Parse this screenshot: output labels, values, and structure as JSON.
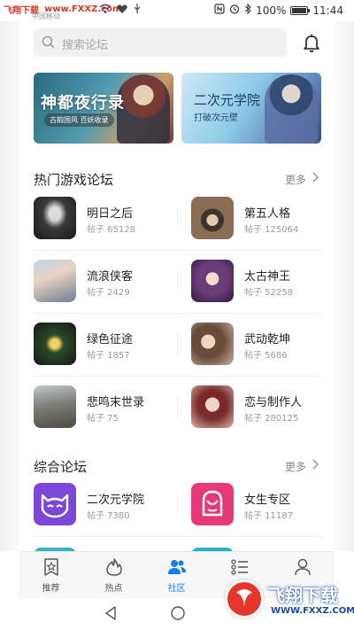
{
  "status_bar": {
    "watermark": "飞翔下载",
    "watermark_url": "www.FXXZ.com",
    "carrier": "中国移动",
    "battery": "100%",
    "battery_level": 1.0,
    "time": "11:44"
  },
  "search": {
    "placeholder": "搜索论坛"
  },
  "banners": [
    {
      "title": "神都夜行录",
      "subtitle": "古韵国风 百妖收录"
    },
    {
      "title": "二次元学院",
      "subtitle": "打破次元壁"
    }
  ],
  "hot_section": {
    "title": "热门游戏论坛",
    "more": "更多",
    "items": [
      {
        "name": "明日之后",
        "posts": "帖子 65128"
      },
      {
        "name": "第五人格",
        "posts": "帖子 125064"
      },
      {
        "name": "流浪侠客",
        "posts": "帖子 2429"
      },
      {
        "name": "太古神王",
        "posts": "帖子 52258"
      },
      {
        "name": "绿色征途",
        "posts": "帖子 1857"
      },
      {
        "name": "武动乾坤",
        "posts": "帖子 5686"
      },
      {
        "name": "悲鸣末世录",
        "posts": "帖子 75"
      },
      {
        "name": "恋与制作人",
        "posts": "帖子 280125"
      }
    ]
  },
  "general_section": {
    "title": "综合论坛",
    "more": "更多",
    "items": [
      {
        "name": "二次元学院",
        "posts": "帖子 7380"
      },
      {
        "name": "女生专区",
        "posts": "帖子 11187"
      }
    ]
  },
  "tabbar": {
    "tabs": [
      {
        "label": "推荐",
        "icon": "star-badge-icon"
      },
      {
        "label": "热点",
        "icon": "flame-icon"
      },
      {
        "label": "社区",
        "icon": "people-icon"
      },
      {
        "label": "",
        "icon": "list-icon"
      },
      {
        "label": "",
        "icon": "person-icon"
      }
    ],
    "active_color": "#1a7de0"
  },
  "watermark_logo": {
    "text": "飞翔下载",
    "url": "WWW.FXXZ.COM"
  }
}
